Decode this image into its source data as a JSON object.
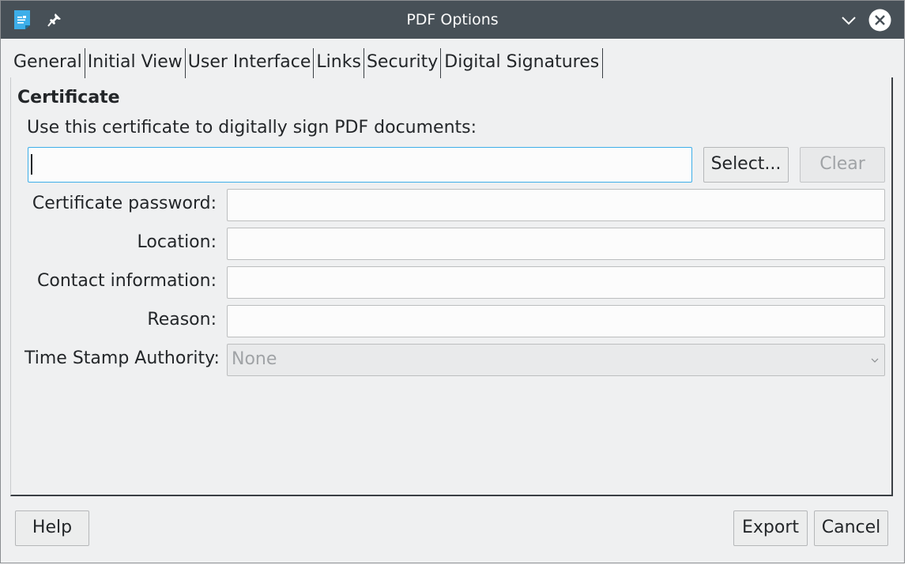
{
  "window": {
    "title": "PDF Options"
  },
  "tabs": [
    {
      "label": "General"
    },
    {
      "label": "Initial View"
    },
    {
      "label": "User Interface"
    },
    {
      "label": "Links"
    },
    {
      "label": "Security"
    },
    {
      "label": "Digital Signatures"
    }
  ],
  "certificate": {
    "section_title": "Certificate",
    "use_label": "Use this certificate to digitally sign PDF documents:",
    "certificate_value": "",
    "select_button": "Select...",
    "clear_button": "Clear",
    "password_label": "Certificate password:",
    "password_value": "",
    "location_label": "Location:",
    "location_value": "",
    "contact_label": "Contact information:",
    "contact_value": "",
    "reason_label": "Reason:",
    "reason_value": "",
    "tsa_label": "Time Stamp Authority:",
    "tsa_value": "None"
  },
  "footer": {
    "help_button": "Help",
    "export_button": "Export",
    "cancel_button": "Cancel"
  },
  "icons": {
    "app": "document-icon",
    "pin": "pin-icon",
    "minimize": "chevron-down-icon",
    "close": "close-icon"
  },
  "colors": {
    "titlebar": "#475057",
    "background": "#eff0f1",
    "focus": "#3daee9"
  }
}
